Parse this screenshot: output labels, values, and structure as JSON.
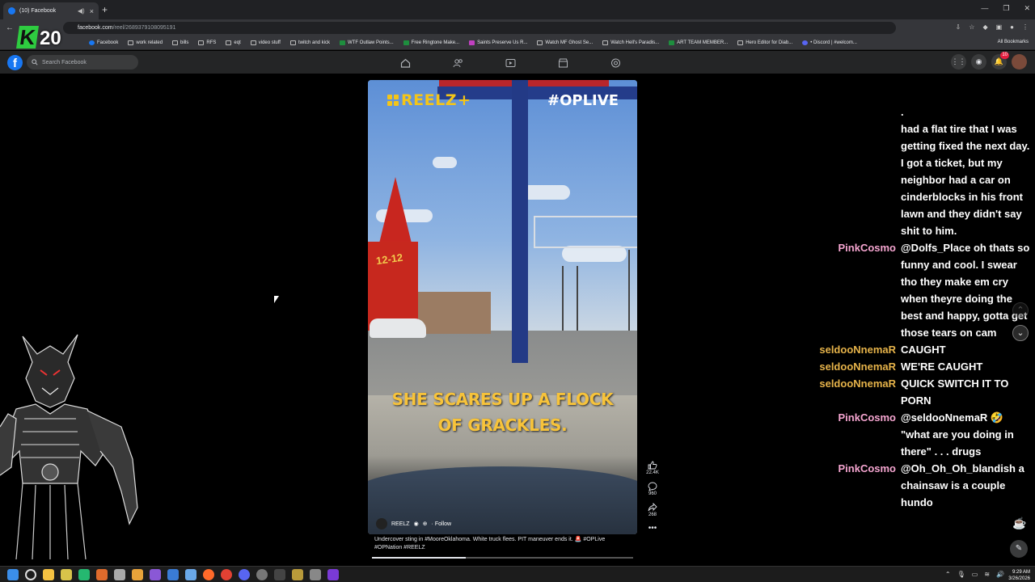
{
  "browser": {
    "tab_title": "(10) Facebook",
    "url_host": "facebook.com",
    "url_path": "/reel/2689379108095191",
    "bookmarks": [
      {
        "label": "Facebook",
        "icon": "facebook-icon"
      },
      {
        "label": "work related",
        "icon": "folder-icon"
      },
      {
        "label": "bills",
        "icon": "folder-icon"
      },
      {
        "label": "RFS",
        "icon": "folder-icon"
      },
      {
        "label": "eqt",
        "icon": "folder-icon"
      },
      {
        "label": "video stuff",
        "icon": "folder-icon"
      },
      {
        "label": "twitch and kick",
        "icon": "folder-icon"
      },
      {
        "label": "WTF Outlaw Points...",
        "icon": "sheet-icon"
      },
      {
        "label": "Free Ringtone Make...",
        "icon": "site-icon"
      },
      {
        "label": "Saints Preserve Us R...",
        "icon": "site-icon"
      },
      {
        "label": "Watch MF Ghost Se...",
        "icon": "site-icon"
      },
      {
        "label": "Watch Hell's Paradis...",
        "icon": "site-icon"
      },
      {
        "label": "ART TEAM MEMBER...",
        "icon": "sheet-icon"
      },
      {
        "label": "Hero Editor for Diab...",
        "icon": "site-icon"
      },
      {
        "label": "• Discord | #welcom...",
        "icon": "discord-icon"
      }
    ],
    "all_bookmarks": "All Bookmarks"
  },
  "overlay": {
    "k_letter": "K",
    "k_number": "20"
  },
  "facebook": {
    "search_placeholder": "Search Facebook",
    "messenger_badge": "",
    "notif_badge": "10"
  },
  "reel": {
    "channel_logo": "REELZ",
    "channel_plus": "+",
    "hashtag": "#OPLIVE",
    "caption_line1": "SHE SCARES UP A FLOCK",
    "caption_line2": "OF GRACKLES.",
    "store_sign": "12-12",
    "author": "REELZ",
    "follow": "· Follow",
    "description": "Undercover sting in #MooreOklahoma. White truck flees. PIT maneuver ends it. 🚨 #OPLive #OPNation #REELZ",
    "progress": 0.36,
    "likes": "22.4K",
    "comments": "960",
    "shares": "268"
  },
  "chat": {
    "messages": [
      {
        "user": "",
        "text": ".",
        "color": "pink"
      },
      {
        "user": "",
        "text": "had a flat tire that I was getting fixed the next day. I got a ticket, but my neighbor had a car on cinderblocks in his front lawn and they didn't say shit to him.",
        "color": "pink"
      },
      {
        "user": "PinkCosmo",
        "text": "@Dolfs_Place oh thats so funny and cool. I swear tho they make em cry when theyre doing the best and happy, gotta get those tears on cam",
        "color": "pink"
      },
      {
        "user": "seldooNnemaR",
        "text": "CAUGHT",
        "color": "gold"
      },
      {
        "user": "seldooNnemaR",
        "text": "WE'RE CAUGHT",
        "color": "gold"
      },
      {
        "user": "seldooNnemaR",
        "text": "QUICK SWITCH IT TO PORN",
        "color": "gold"
      },
      {
        "user": "PinkCosmo",
        "text": "@seldooNnemaR 🤣 \"what are you doing in there\" . . . drugs",
        "color": "pink"
      },
      {
        "user": "PinkCosmo",
        "text": "@Oh_Oh_Oh_blandish a chainsaw is a couple hundo",
        "color": "pink"
      }
    ]
  },
  "taskbar": {
    "time": "9:29 AM",
    "date": "3/26/2026"
  }
}
